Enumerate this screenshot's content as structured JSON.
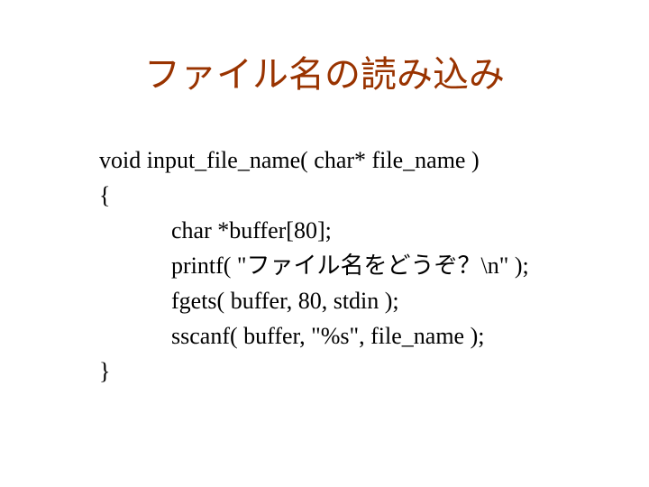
{
  "title": "ファイル名の読み込み",
  "code": {
    "line1": "void input_file_name( char* file_name )",
    "line2": "{",
    "line3": "char *buffer[80];",
    "line4": "printf( \"ファイル名をどうぞ？\\n\" );",
    "line5": "fgets( buffer, 80, stdin );",
    "line6": "sscanf( buffer, \"%s\", file_name );",
    "line7": "}"
  }
}
